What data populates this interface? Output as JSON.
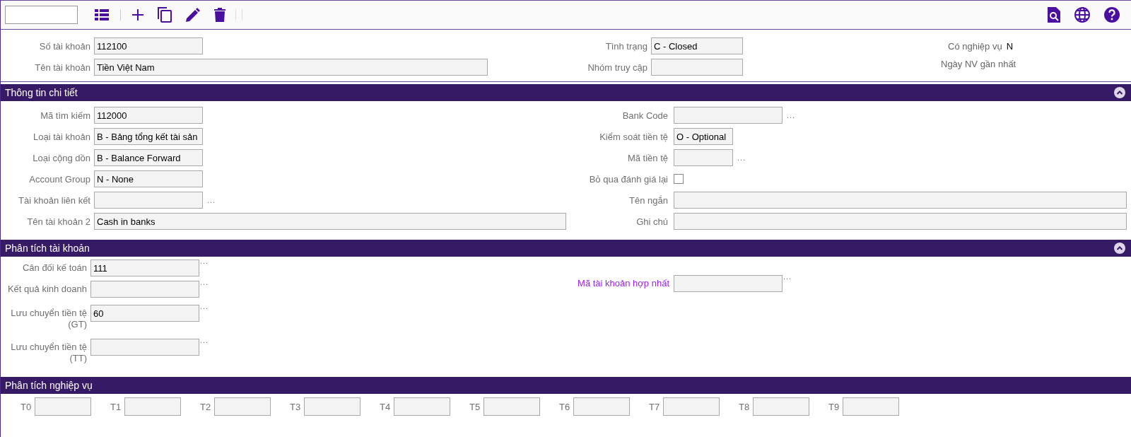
{
  "header": {
    "left": [
      {
        "kind": "text",
        "label": "Số tài khoản",
        "value": "112100"
      },
      {
        "kind": "text",
        "label": "Tên tài khoản",
        "value": "Tiền Việt Nam"
      }
    ],
    "middle": [
      {
        "kind": "text",
        "label": "Tình trạng",
        "value": "C - Closed"
      },
      {
        "kind": "text",
        "label": "Nhóm truy cập"
      }
    ],
    "right": [
      {
        "label": "Có nghiệp vụ",
        "value": "N"
      },
      {
        "label": "Ngày NV gần nhất"
      }
    ]
  },
  "sections": [
    {
      "title": "Thông tin chi tiết",
      "collapsible": true,
      "kind": "detail",
      "left": [
        {
          "kind": "text",
          "label": "Mã tìm kiếm",
          "value": "112000"
        },
        {
          "kind": "text",
          "label": "Loại tài khoản",
          "value": "B - Bảng tổng kết tài sản"
        },
        {
          "kind": "text",
          "label": "Loại cộng dồn",
          "value": "B - Balance Forward"
        },
        {
          "kind": "text",
          "label": "Account Group",
          "value": "N - None"
        },
        {
          "kind": "lookup",
          "label": "Tài khoản liên kết",
          "more": "..."
        },
        {
          "kind": "text",
          "label": "Tên tài khoản 2",
          "value": "Cash in banks"
        }
      ],
      "right": [
        {
          "kind": "lookup",
          "label": "Bank Code",
          "more": "..."
        },
        {
          "kind": "text",
          "label": "Kiểm soát tiền tệ",
          "value": "O - Optional"
        },
        {
          "kind": "lookup",
          "label": "Mã tiền tệ",
          "more": "..."
        },
        {
          "kind": "checkbox",
          "label": "Bỏ qua đánh giá lại",
          "checked": false
        },
        {
          "kind": "text",
          "label": "Tên ngắn"
        },
        {
          "kind": "text",
          "label": "Ghi chú"
        }
      ]
    },
    {
      "title": "Phân tích tài khoản",
      "collapsible": true,
      "kind": "analysis",
      "left": [
        {
          "kind": "lookup",
          "label": "Cân đối kế toán",
          "value": "111",
          "more": "..."
        },
        {
          "kind": "lookup",
          "label": "Kết quả kinh doanh",
          "more": "..."
        },
        {
          "kind": "lookup",
          "label": "Lưu chuyển tiền tệ (GT)",
          "value": "60",
          "more": "..."
        },
        {
          "kind": "lookup",
          "label": "Lưu chuyển tiền tệ (TT)",
          "more": "..."
        }
      ],
      "right": [
        {
          "kind": "lookup",
          "label": "Mã tài khoản hợp nhất",
          "more": "...",
          "link": true
        }
      ]
    },
    {
      "title": "Phân tích nghiệp vụ",
      "collapsible": false,
      "kind": "codes",
      "codes": [
        {
          "label": "T0"
        },
        {
          "label": "T1"
        },
        {
          "label": "T2"
        },
        {
          "label": "T3"
        },
        {
          "label": "T4"
        },
        {
          "label": "T5"
        },
        {
          "label": "T6"
        },
        {
          "label": "T7"
        },
        {
          "label": "T8"
        },
        {
          "label": "T9"
        }
      ]
    }
  ]
}
